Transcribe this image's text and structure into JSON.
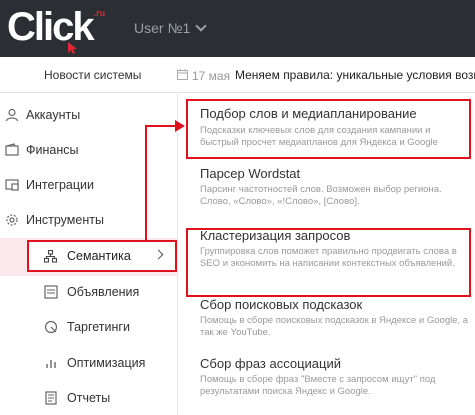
{
  "header": {
    "logo_text": "Click",
    "logo_suffix": ".ru",
    "user_name": "User №1"
  },
  "news": {
    "link_label": "Новости системы",
    "date": "17 мая",
    "title": "Меняем правила: уникальные условия возна"
  },
  "sidebar": {
    "items": [
      {
        "label": "Аккаунты",
        "icon": "user-icon"
      },
      {
        "label": "Финансы",
        "icon": "wallet-icon"
      },
      {
        "label": "Интеграции",
        "icon": "integration-icon"
      },
      {
        "label": "Инструменты",
        "icon": "gear-icon"
      }
    ],
    "sub_items": [
      {
        "label": "Семантика",
        "icon": "semantic-tree-icon",
        "active": true
      },
      {
        "label": "Объявления",
        "icon": "ads-icon"
      },
      {
        "label": "Таргетинги",
        "icon": "target-icon"
      },
      {
        "label": "Оптимизация",
        "icon": "chart-icon"
      },
      {
        "label": "Отчеты",
        "icon": "report-icon"
      }
    ]
  },
  "tools": [
    {
      "title": "Подбор слов и медиапланирование",
      "desc": "Подсказки ключевых слов для создания кампании и быстрый просчет медиапланов для Яндекса и Google"
    },
    {
      "title": "Парсер Wordstat",
      "desc": "Парсинг частотностей слов. Возможен выбор региона. Слово, «Слово», «!Слово», [Слово]."
    },
    {
      "title": "Кластеризация запросов",
      "desc": "Группировка слов поможет правильно продвигать слова в SEO и экономить на написании контекстных объявлений."
    },
    {
      "title": "Сбор поисковых подсказок",
      "desc": "Помощь в сборе поисковых подсказок в Яндексе и Google, а так же YouTube."
    },
    {
      "title": "Сбор фраз ассоциаций",
      "desc": "Помощь в сборе фраз \"Вместе с запросом ищут\" под результатами поиска Яндекс и Google."
    }
  ],
  "colors": {
    "header_bg": "#2b2e33",
    "accent_red": "#e0101c",
    "active_bg": "#fbe8ea"
  }
}
